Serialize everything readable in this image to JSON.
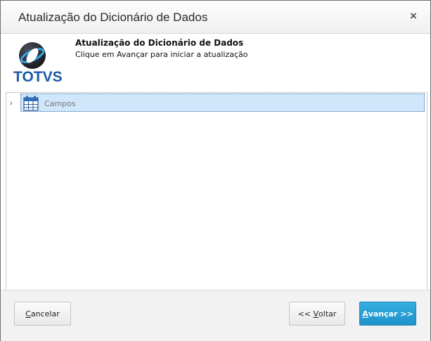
{
  "window": {
    "title": "Atualização do Dicionário de Dados",
    "close_glyph": "×"
  },
  "header": {
    "logo_text": "TOTVS",
    "title": "Atualização do Dicionário de Dados",
    "subtitle": "Clique em Avançar para iniciar a atualização"
  },
  "tree": {
    "items": [
      {
        "label": "Campos",
        "icon": "table-icon",
        "expander_glyph": "›",
        "selected": true
      }
    ]
  },
  "footer": {
    "cancel": {
      "mnemonic": "C",
      "rest": "ancelar"
    },
    "back": {
      "prefix": "<< ",
      "mnemonic": "V",
      "rest": "oltar"
    },
    "next": {
      "mnemonic": "A",
      "rest": "vançar >>"
    }
  },
  "colors": {
    "accent": "#2aa3d9",
    "selection": "#cfe6fb",
    "logo_blue": "#1a5aa8"
  }
}
